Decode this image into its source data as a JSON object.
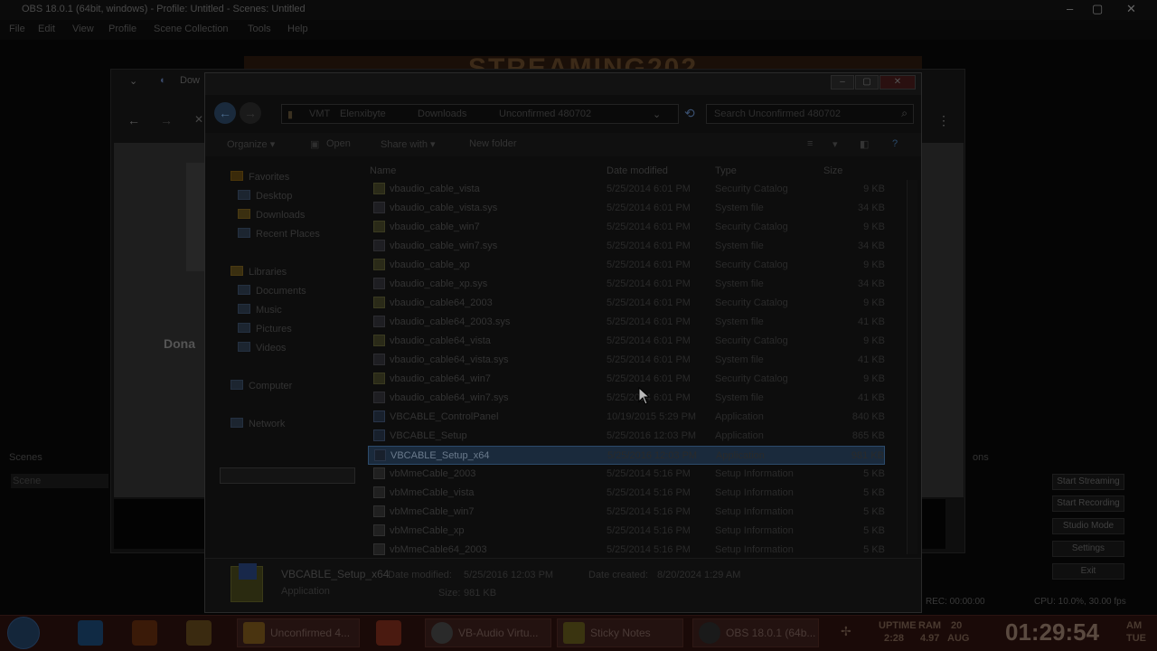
{
  "obs": {
    "title": "OBS 18.0.1 (64bit, windows) - Profile: Untitled - Scenes: Untitled",
    "menu": [
      "File",
      "Edit",
      "View",
      "Profile",
      "Scene Collection",
      "Tools",
      "Help"
    ],
    "banner": "STREAMING202",
    "browser_tab": "Dow",
    "donate_text": "Dona",
    "scenes_label": "Scenes",
    "scenes_item": "Scene",
    "right_label": "ons",
    "buttons": [
      "Start Streaming",
      "Start Recording",
      "Studio Mode",
      "Settings",
      "Exit"
    ],
    "status_rec": "REC: 00:00:00",
    "status_cpu": "CPU: 10.0%, 30.00 fps"
  },
  "explorer": {
    "title": "",
    "breadcrumb": [
      "VMT",
      "Elenxibyte",
      "Downloads",
      "Unconfirmed 480702"
    ],
    "search_placeholder": "Search Unconfirmed 480702",
    "toolbar": {
      "organize": "Organize ▾",
      "open": "Open",
      "share_with": "Share with ▾",
      "new_folder": "New folder"
    },
    "nav": {
      "favorites": "Favorites",
      "desktop": "Desktop",
      "downloads": "Downloads",
      "recent_places": "Recent Places",
      "libraries": "Libraries",
      "documents": "Documents",
      "music": "Music",
      "pictures": "Pictures",
      "videos": "Videos",
      "computer": "Computer",
      "network": "Network"
    },
    "columns": {
      "name": "Name",
      "date": "Date modified",
      "type": "Type",
      "size": "Size"
    },
    "files": [
      {
        "name": "vbaudio_cable_vista",
        "date": "5/25/2014 6:01 PM",
        "type": "Security Catalog",
        "size": "9 KB",
        "kind": "cat"
      },
      {
        "name": "vbaudio_cable_vista.sys",
        "date": "5/25/2014 6:01 PM",
        "type": "System file",
        "size": "34 KB",
        "kind": "sys"
      },
      {
        "name": "vbaudio_cable_win7",
        "date": "5/25/2014 6:01 PM",
        "type": "Security Catalog",
        "size": "9 KB",
        "kind": "cat"
      },
      {
        "name": "vbaudio_cable_win7.sys",
        "date": "5/25/2014 6:01 PM",
        "type": "System file",
        "size": "34 KB",
        "kind": "sys"
      },
      {
        "name": "vbaudio_cable_xp",
        "date": "5/25/2014 6:01 PM",
        "type": "Security Catalog",
        "size": "9 KB",
        "kind": "cat"
      },
      {
        "name": "vbaudio_cable_xp.sys",
        "date": "5/25/2014 6:01 PM",
        "type": "System file",
        "size": "34 KB",
        "kind": "sys"
      },
      {
        "name": "vbaudio_cable64_2003",
        "date": "5/25/2014 6:01 PM",
        "type": "Security Catalog",
        "size": "9 KB",
        "kind": "cat"
      },
      {
        "name": "vbaudio_cable64_2003.sys",
        "date": "5/25/2014 6:01 PM",
        "type": "System file",
        "size": "41 KB",
        "kind": "sys"
      },
      {
        "name": "vbaudio_cable64_vista",
        "date": "5/25/2014 6:01 PM",
        "type": "Security Catalog",
        "size": "9 KB",
        "kind": "cat"
      },
      {
        "name": "vbaudio_cable64_vista.sys",
        "date": "5/25/2014 6:01 PM",
        "type": "System file",
        "size": "41 KB",
        "kind": "sys"
      },
      {
        "name": "vbaudio_cable64_win7",
        "date": "5/25/2014 6:01 PM",
        "type": "Security Catalog",
        "size": "9 KB",
        "kind": "cat"
      },
      {
        "name": "vbaudio_cable64_win7.sys",
        "date": "5/25/2014 6:01 PM",
        "type": "System file",
        "size": "41 KB",
        "kind": "sys"
      },
      {
        "name": "VBCABLE_ControlPanel",
        "date": "10/19/2015 5:29 PM",
        "type": "Application",
        "size": "840 KB",
        "kind": "app"
      },
      {
        "name": "VBCABLE_Setup",
        "date": "5/25/2016 12:03 PM",
        "type": "Application",
        "size": "865 KB",
        "kind": "app"
      },
      {
        "name": "VBCABLE_Setup_x64",
        "date": "5/25/2016 12:03 PM",
        "type": "Application",
        "size": "981 KB",
        "kind": "app",
        "selected": true
      },
      {
        "name": "vbMmeCable_2003",
        "date": "5/25/2014 5:16 PM",
        "type": "Setup Information",
        "size": "5 KB",
        "kind": "inf"
      },
      {
        "name": "vbMmeCable_vista",
        "date": "5/25/2014 5:16 PM",
        "type": "Setup Information",
        "size": "5 KB",
        "kind": "inf"
      },
      {
        "name": "vbMmeCable_win7",
        "date": "5/25/2014 5:16 PM",
        "type": "Setup Information",
        "size": "5 KB",
        "kind": "inf"
      },
      {
        "name": "vbMmeCable_xp",
        "date": "5/25/2014 5:16 PM",
        "type": "Setup Information",
        "size": "5 KB",
        "kind": "inf"
      },
      {
        "name": "vbMmeCable64_2003",
        "date": "5/25/2014 5:16 PM",
        "type": "Setup Information",
        "size": "5 KB",
        "kind": "inf"
      }
    ],
    "details": {
      "name": "VBCABLE_Setup_x64",
      "kind": "Application",
      "modified_label": "Date modified:",
      "modified": "5/25/2016 12:03 PM",
      "created_label": "Date created:",
      "created": "8/20/2024 1:29 AM",
      "size_label": "Size:",
      "size": "981 KB"
    }
  },
  "taskbar": {
    "items": [
      "Unconfirmed 4...",
      "VB-Audio Virtu...",
      "Sticky Notes",
      "OBS 18.0.1 (64b..."
    ],
    "uptime_label": "UPTIME",
    "uptime": "2:28",
    "ram_label": "RAM",
    "ram": "4.97",
    "date_day": "20",
    "date_month": "AUG",
    "clock": "01:29:54",
    "ampm": "AM",
    "weekday": "TUE"
  }
}
